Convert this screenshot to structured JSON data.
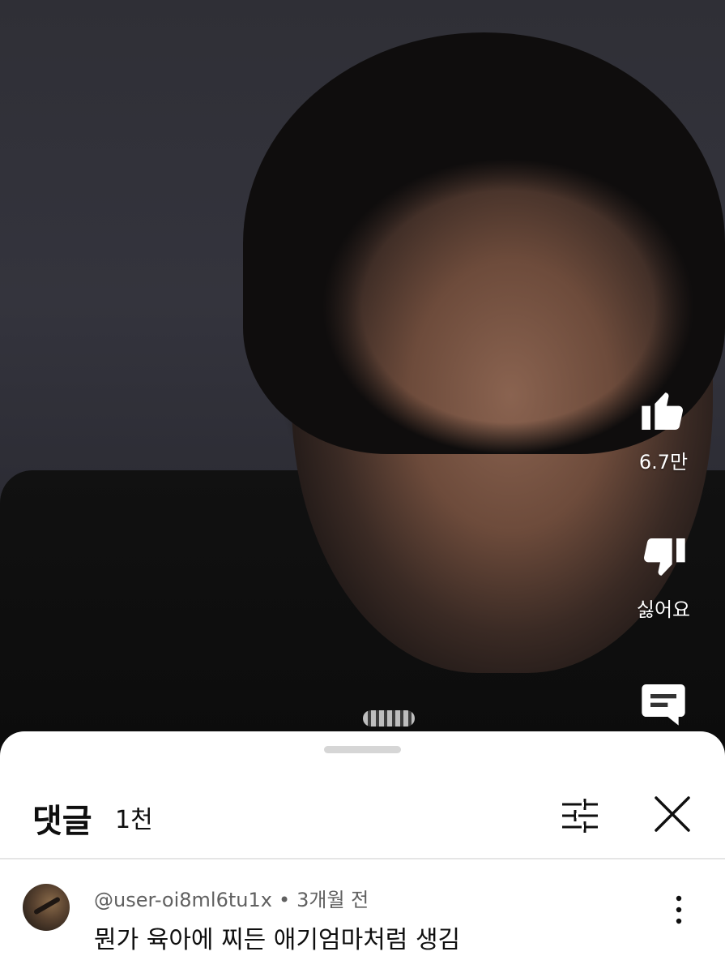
{
  "video": {
    "actions": {
      "like": {
        "icon": "thumbs-up-icon",
        "label": "6.7만"
      },
      "dislike": {
        "icon": "thumbs-down-icon",
        "label": "싫어요"
      },
      "comments": {
        "icon": "comment-icon"
      }
    }
  },
  "comments_panel": {
    "title": "댓글",
    "count": "1천",
    "sort_icon": "sort-filter-icon",
    "close_icon": "close-icon",
    "comments": [
      {
        "author": "@user-oi8ml6tu1x",
        "separator": "•",
        "time": "3개월 전",
        "text": "뭔가 육아에 찌든 애기엄마처럼 생김",
        "more_icon": "more-vertical-icon"
      }
    ]
  }
}
